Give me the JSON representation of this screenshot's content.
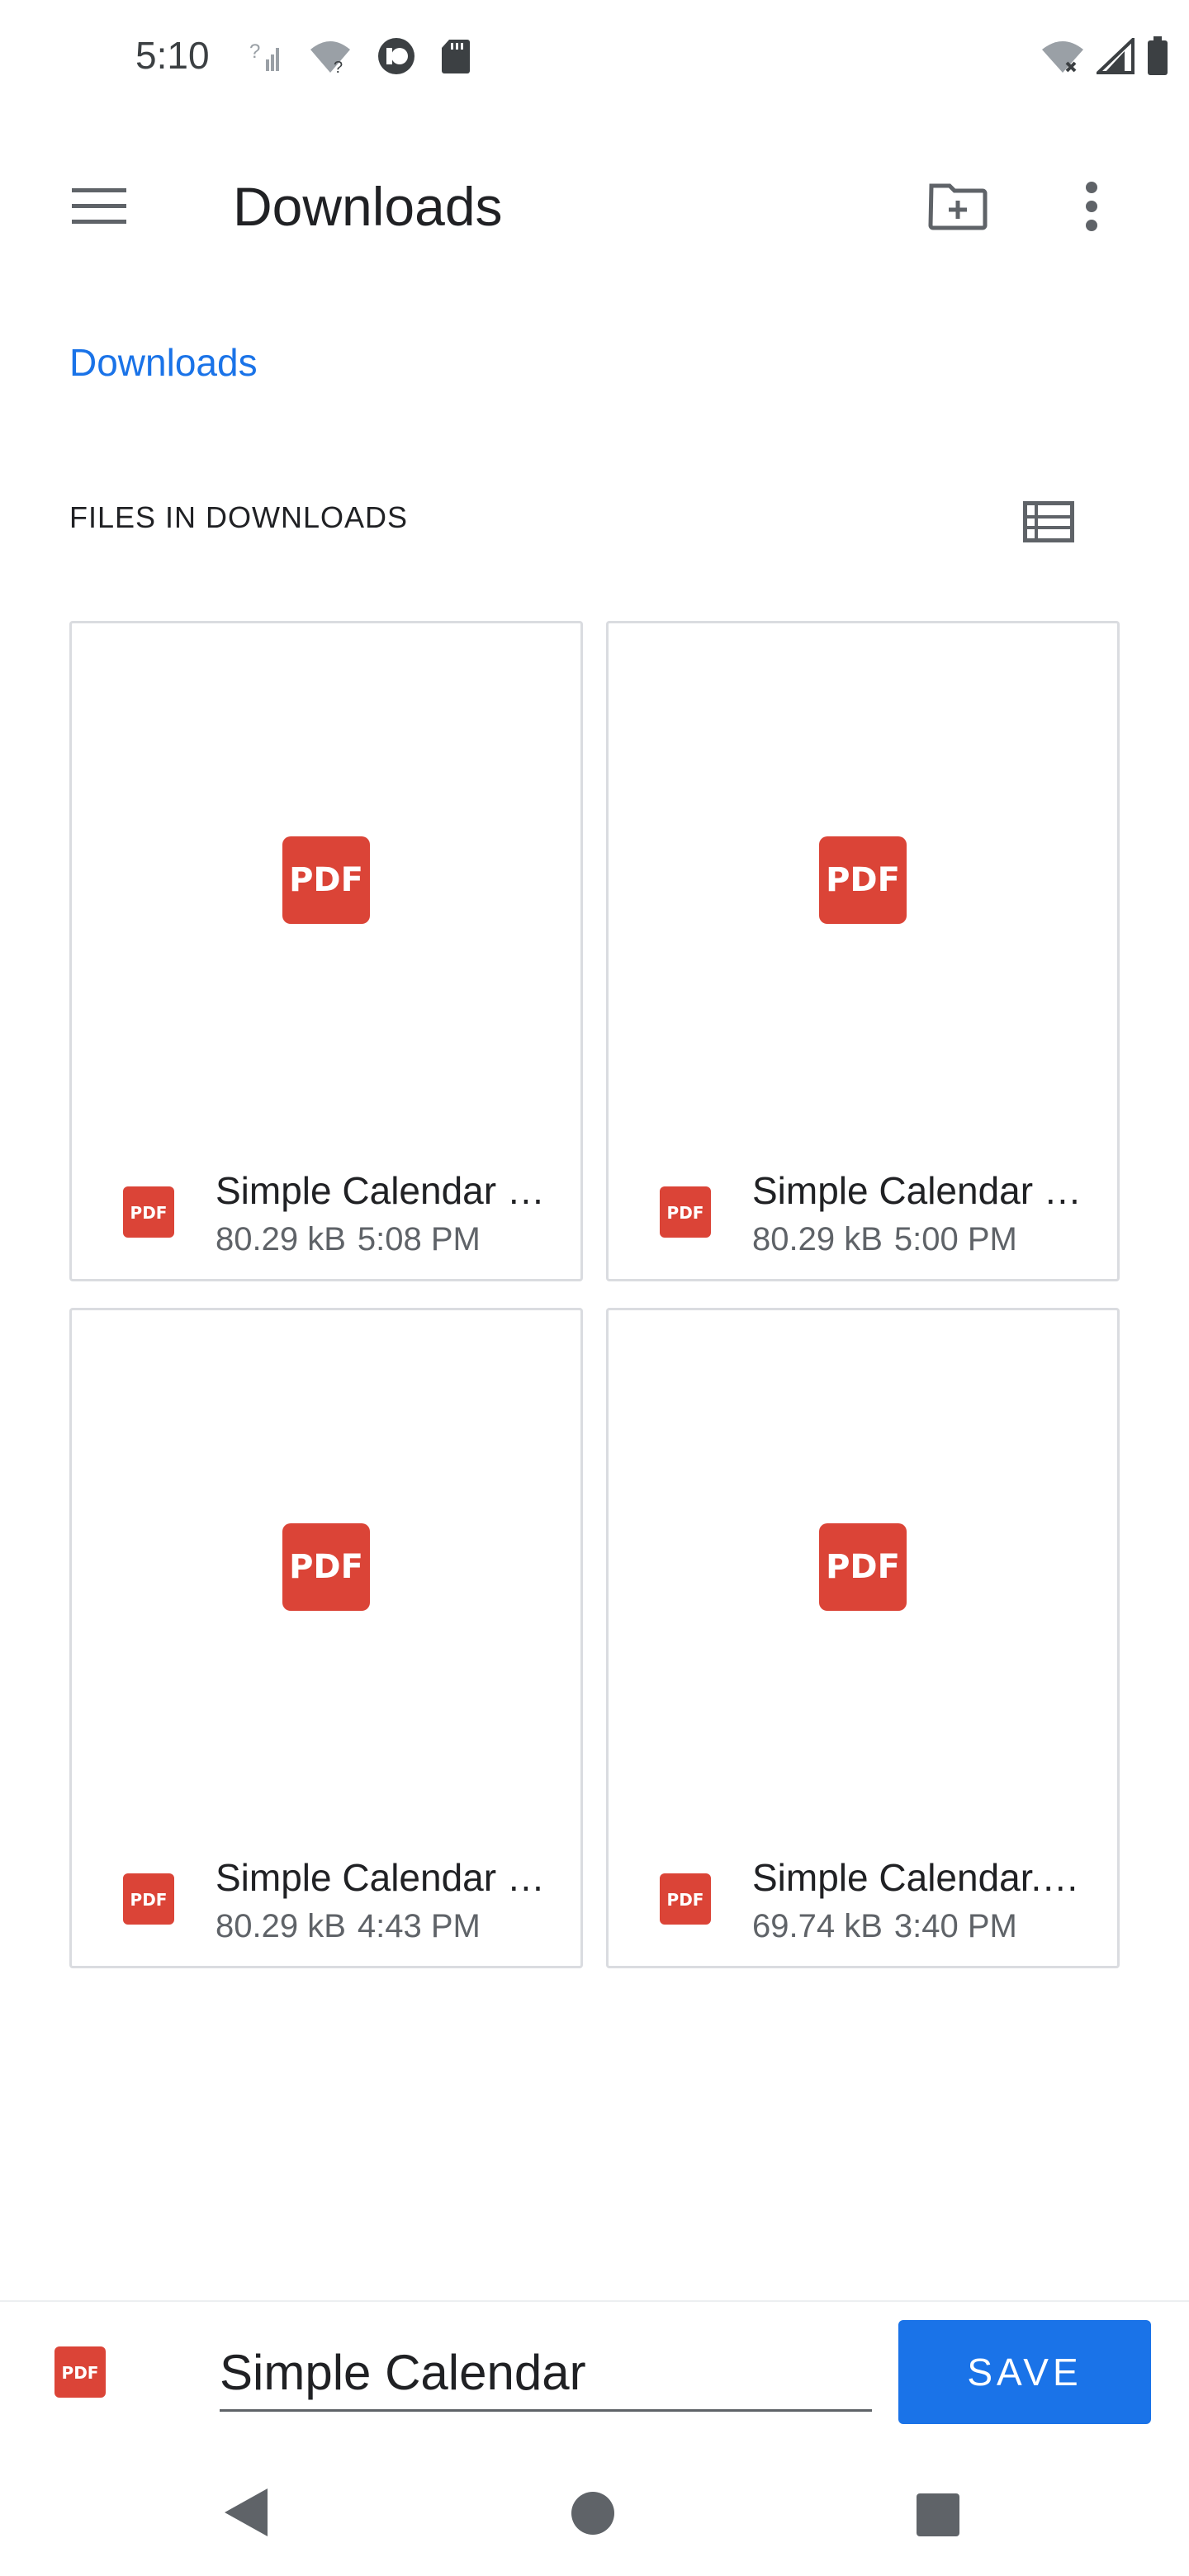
{
  "status_bar": {
    "time": "5:10",
    "left_icons": [
      "signal-unknown-icon",
      "wifi-unknown-icon",
      "vpn-key-icon",
      "sd-card-icon"
    ],
    "right_icons": [
      "wifi-no-internet-icon",
      "cell-signal-icon",
      "battery-icon"
    ]
  },
  "app_bar": {
    "title": "Downloads"
  },
  "breadcrumb": {
    "label": "Downloads"
  },
  "section": {
    "header": "FILES IN DOWNLOADS"
  },
  "files": [
    {
      "name": "Simple Calendar …",
      "size": "80.29 kB",
      "time": "5:08 PM"
    },
    {
      "name": "Simple Calendar …",
      "size": "80.29 kB",
      "time": "5:00 PM"
    },
    {
      "name": "Simple Calendar …",
      "size": "80.29 kB",
      "time": "4:43 PM"
    },
    {
      "name": "Simple Calendar.…",
      "size": "69.74 kB",
      "time": "3:40 PM"
    }
  ],
  "save_bar": {
    "filename_value": "Simple Calendar",
    "save_label": "SAVE"
  },
  "icons": {
    "pdf_text": "PDF"
  },
  "colors": {
    "accent": "#1a73e8",
    "pdf_red": "#db4437"
  }
}
